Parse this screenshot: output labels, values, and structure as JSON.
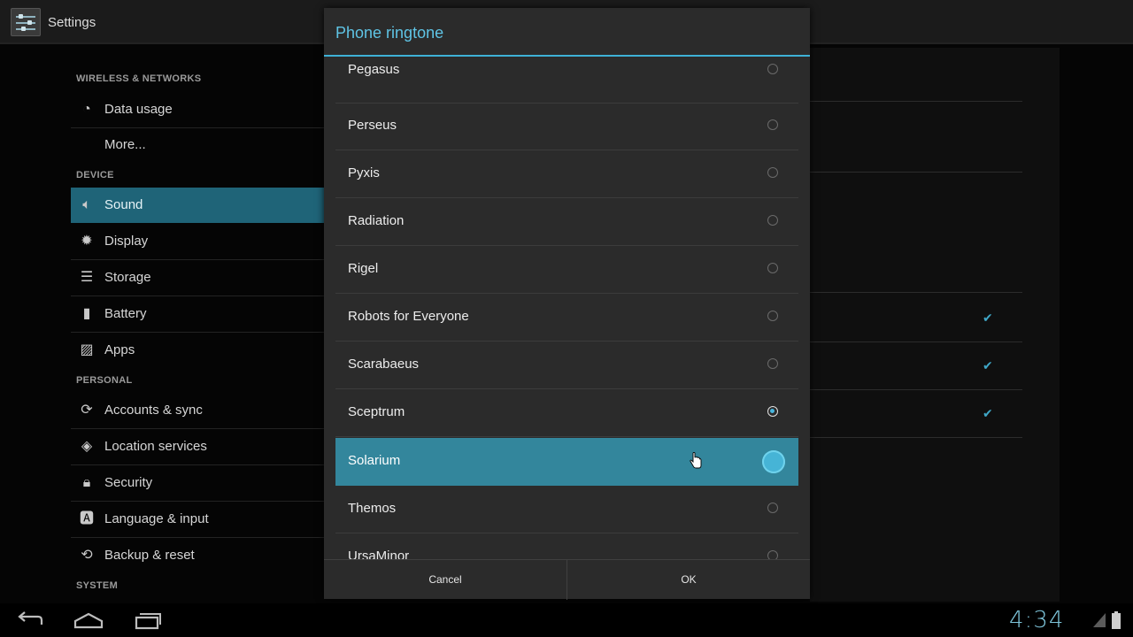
{
  "actionbar": {
    "title": "Settings",
    "icon": "settings-icon"
  },
  "sidebar": {
    "sections": [
      {
        "header": "WIRELESS & NETWORKS"
      },
      {
        "header": "DEVICE"
      },
      {
        "header": "PERSONAL"
      },
      {
        "header": "SYSTEM"
      }
    ],
    "items": [
      {
        "label": "Data usage",
        "icon": "data-usage-icon"
      },
      {
        "label": "More...",
        "icon": ""
      },
      {
        "label": "Sound",
        "icon": "speaker-icon",
        "selected": true
      },
      {
        "label": "Display",
        "icon": "brightness-icon"
      },
      {
        "label": "Storage",
        "icon": "storage-icon"
      },
      {
        "label": "Battery",
        "icon": "battery-icon"
      },
      {
        "label": "Apps",
        "icon": "apps-icon"
      },
      {
        "label": "Accounts & sync",
        "icon": "sync-icon"
      },
      {
        "label": "Location services",
        "icon": "location-icon"
      },
      {
        "label": "Security",
        "icon": "lock-icon"
      },
      {
        "label": "Language & input",
        "icon": "language-icon"
      },
      {
        "label": "Backup & reset",
        "icon": "backup-icon"
      }
    ]
  },
  "dialog": {
    "title": "Phone ringtone",
    "options": [
      {
        "label": "Pegasus",
        "checked": false
      },
      {
        "label": "Perseus",
        "checked": false
      },
      {
        "label": "Pyxis",
        "checked": false
      },
      {
        "label": "Radiation",
        "checked": false
      },
      {
        "label": "Rigel",
        "checked": false
      },
      {
        "label": "Robots for Everyone",
        "checked": false
      },
      {
        "label": "Scarabaeus",
        "checked": false
      },
      {
        "label": "Sceptrum",
        "checked": true
      },
      {
        "label": "Solarium",
        "checked": false,
        "pressed": true
      },
      {
        "label": "Themos",
        "checked": false
      },
      {
        "label": "UrsaMinor",
        "checked": false
      }
    ],
    "cancel_label": "Cancel",
    "ok_label": "OK"
  },
  "statusbar": {
    "time": "4:34"
  },
  "colors": {
    "accent": "#33b5e5",
    "selected_item": "#1f6478",
    "pressed_row": "#33869c"
  }
}
